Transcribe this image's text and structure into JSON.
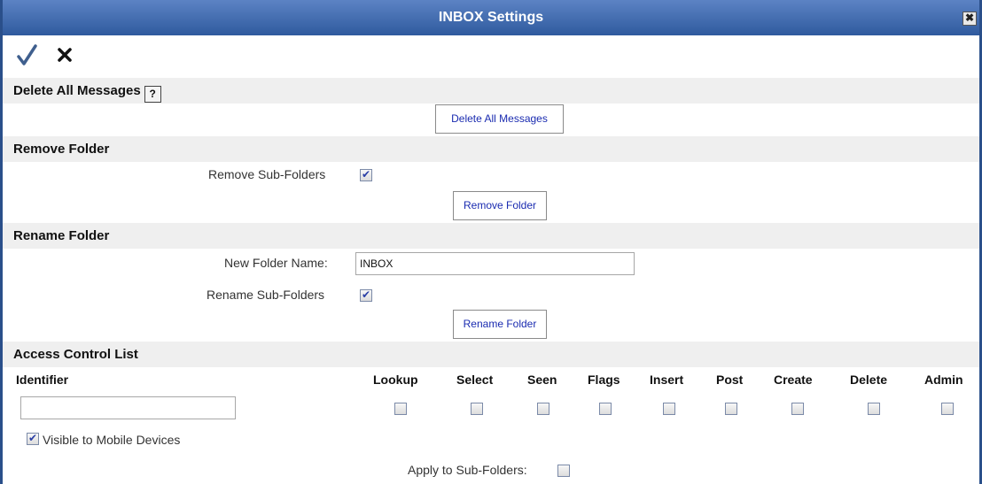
{
  "title": "INBOX Settings",
  "close_glyph": "✖",
  "sections": {
    "delete": {
      "heading": "Delete All Messages",
      "help_glyph": "?",
      "button": "Delete All Messages"
    },
    "remove": {
      "heading": "Remove Folder",
      "subfolders_label": "Remove Sub-Folders",
      "subfolders_checked": true,
      "button": "Remove Folder"
    },
    "rename": {
      "heading": "Rename Folder",
      "new_name_label": "New Folder Name:",
      "new_name_value": "INBOX",
      "subfolders_label": "Rename Sub-Folders",
      "subfolders_checked": true,
      "button": "Rename Folder"
    },
    "acl": {
      "heading": "Access Control List",
      "identifier_header": "Identifier",
      "identifier_value": "",
      "permissions": [
        "Lookup",
        "Select",
        "Seen",
        "Flags",
        "Insert",
        "Post",
        "Create",
        "Delete",
        "Admin"
      ],
      "visible_mobile_label": "Visible to Mobile Devices",
      "visible_mobile_checked": true,
      "apply_subfolders_label": "Apply to Sub-Folders:",
      "apply_subfolders_checked": false
    }
  },
  "icons": {
    "ok": "check-icon",
    "cancel": "x-icon",
    "close": "close-icon",
    "help": "help-icon"
  },
  "colors": {
    "titlebar": "#2f5a9e",
    "section_bg": "#efefef",
    "button_text": "#1a2bb0",
    "checkmark": "#2a3fa6"
  }
}
